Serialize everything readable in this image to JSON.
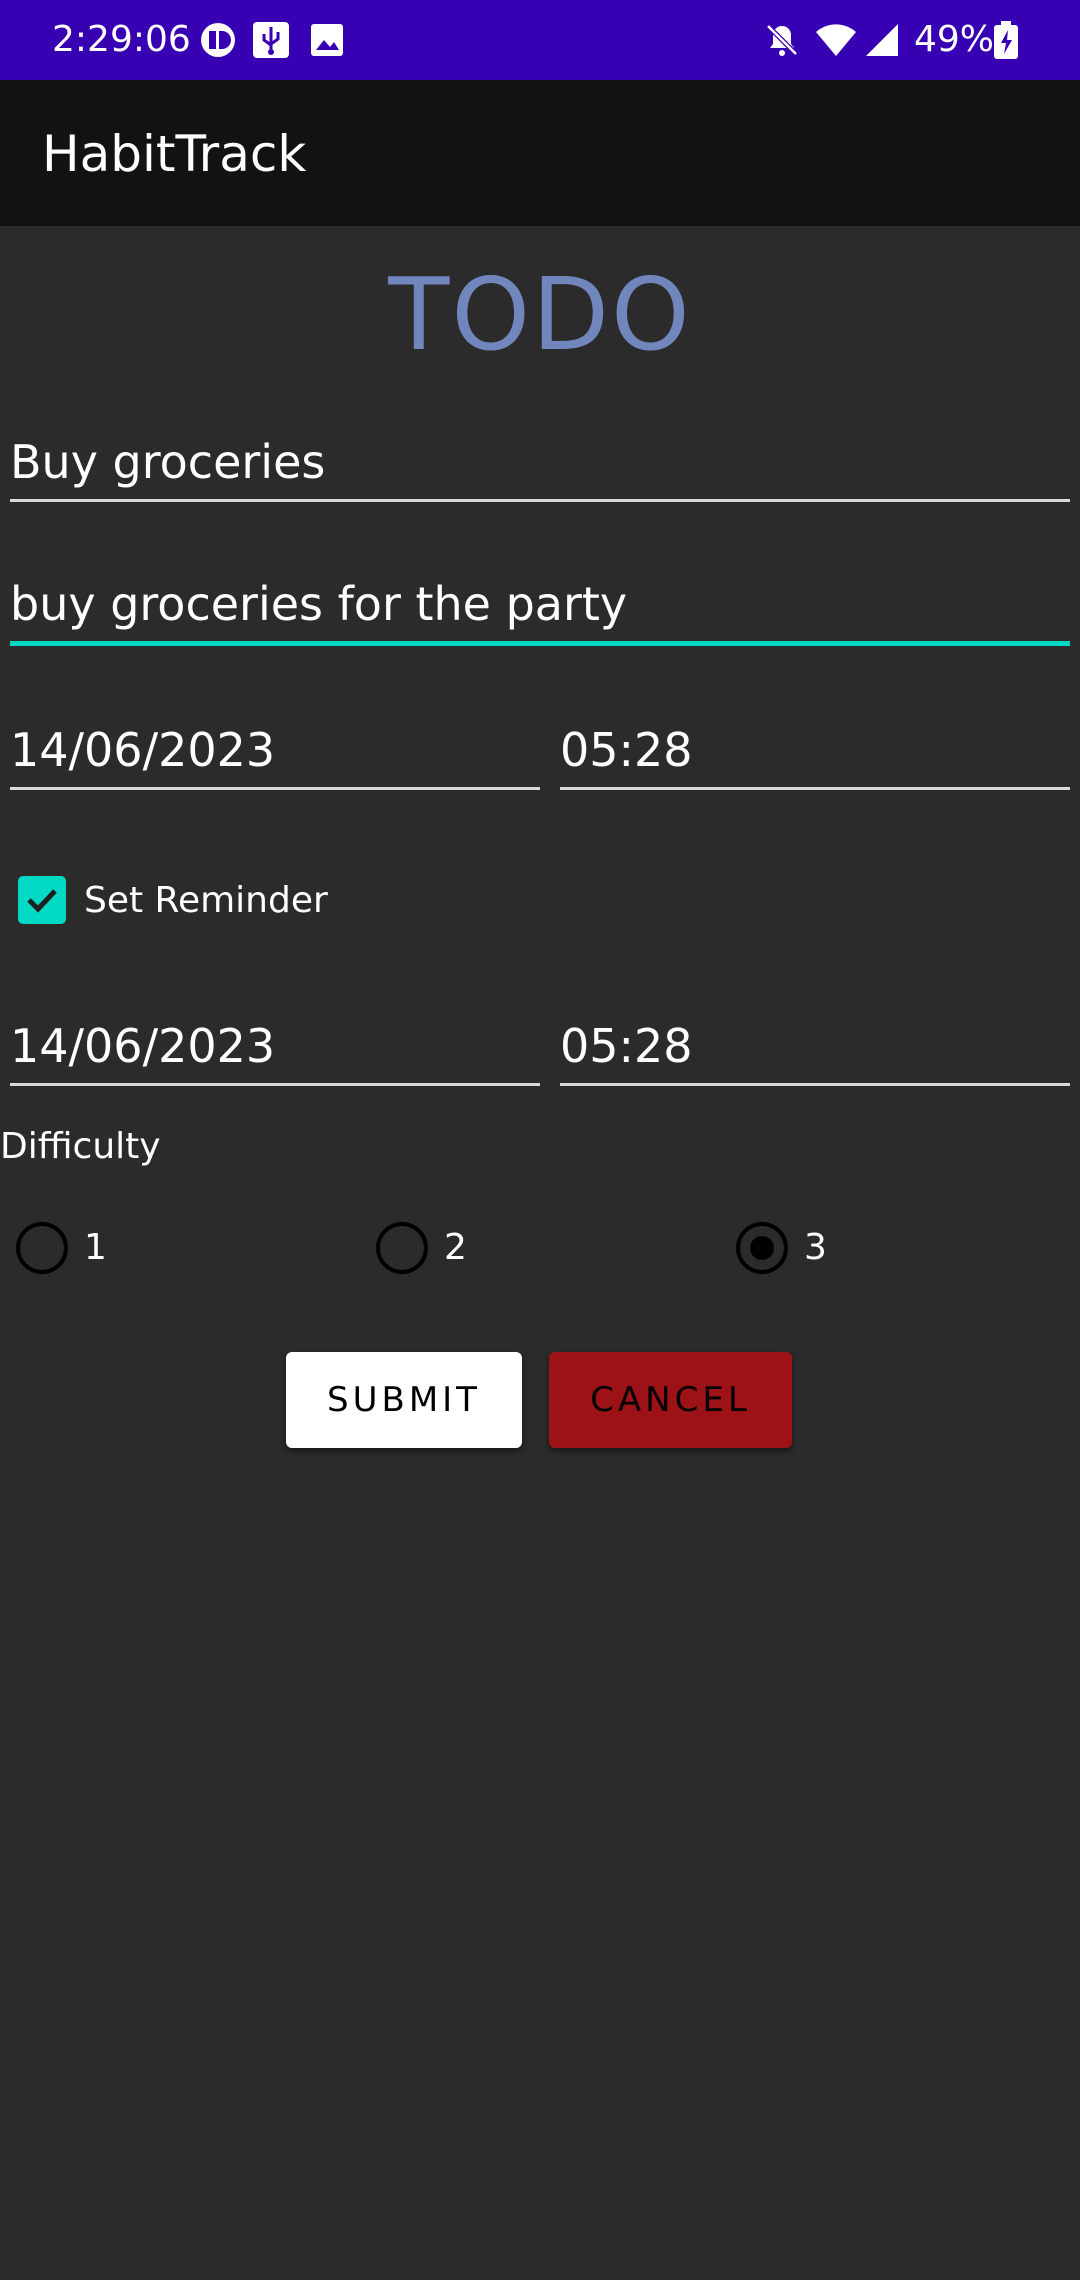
{
  "status_bar": {
    "time": "2:29:06",
    "battery_percent": "49%",
    "icons": [
      "app-notification-icon",
      "usb-icon",
      "image-icon",
      "notifications-off-icon",
      "wifi-icon",
      "cell-signal-icon",
      "battery-charging-icon"
    ]
  },
  "app_bar": {
    "title": "HabitTrack"
  },
  "form": {
    "heading": "TODO",
    "title_value": "Buy groceries",
    "description_value": "buy groceries for the party",
    "due_date": "14/06/2023",
    "due_time": "05:28",
    "reminder_label": "Set Reminder",
    "reminder_checked": true,
    "reminder_date": "14/06/2023",
    "reminder_time": "05:28",
    "difficulty_label": "Difficulty",
    "difficulty_options": [
      "1",
      "2",
      "3"
    ],
    "difficulty_selected": "3",
    "submit_label": "SUBMIT",
    "cancel_label": "CANCEL"
  },
  "colors": {
    "status_bar": "#3700b3",
    "app_bar": "#121212",
    "background": "#2b2b2b",
    "heading": "#7186bd",
    "accent": "#03dac5",
    "cancel_button": "#9c1216"
  }
}
